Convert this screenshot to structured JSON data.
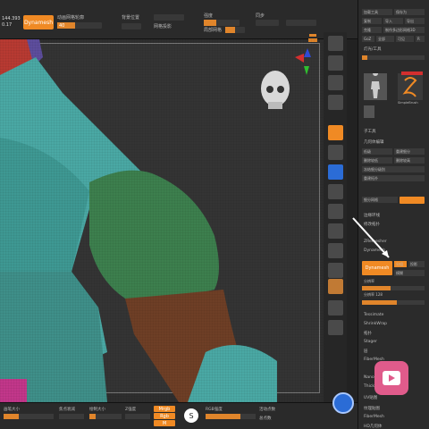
{
  "topbar": {
    "dynamesh_label": "Dynamesh",
    "left_value": "144.393",
    "left_value2": "0.17",
    "labels": [
      "动画网格轮廓",
      "背景位置",
      "网格投影",
      "对称",
      "方向"
    ],
    "right_labels": [
      "强度",
      "局部网格",
      "同步"
    ],
    "value1": "40",
    "value2": "1",
    "value3": "2"
  },
  "side_panel": {
    "header_items": [
      "加载工具",
      "保存为",
      "复制",
      "导入",
      "导出",
      "克隆",
      "制作多边形网格3D",
      "GoZ",
      "全部",
      "可见",
      "R"
    ],
    "tool_section": "灯光/工具",
    "tool_name": "手工具",
    "tool_label2": "SimpleBrush",
    "subtool_label": "子工具",
    "geometry_label": "几何体编辑",
    "items": [
      "细分网格",
      "低级",
      "重建细分",
      "删除较低",
      "删除较高",
      "冻结细分级别",
      "重建拓扑",
      "边缘环线",
      "修改拓扑",
      "ZRemesher",
      "Dynamesh",
      "分组",
      "投影",
      "模糊",
      "分辨率"
    ],
    "dynamesh_button": "Dynamesh",
    "resolution_label": "分辨率 128",
    "lower_items": [
      "Tessimate",
      "ShrinkWrap",
      "拓扑",
      "Stager",
      "层",
      "FiberMesh",
      "NanoMesh",
      "Thick Skin",
      "UV贴图",
      "纹理贴图"
    ],
    "fibermesh_label": "FiberMesh",
    "hd_label": "HD几何体"
  },
  "bottombar": {
    "labels": [
      "画笔大小",
      "焦点衰减",
      "绘制大小",
      "Z强度",
      "RGB强度",
      "活动点数",
      "总点数"
    ],
    "buttons": [
      "Mrgb",
      "Rgb",
      "M",
      "Zadd",
      "Zsub",
      "Zcut"
    ],
    "icon_label": "S"
  },
  "viewport": {
    "model_description": "3D character torso"
  },
  "colors": {
    "accent": "#f08a24",
    "teal": "#4aa8a4",
    "green": "#3d7f4e",
    "red": "#c0392b",
    "brown": "#6e3f26"
  }
}
